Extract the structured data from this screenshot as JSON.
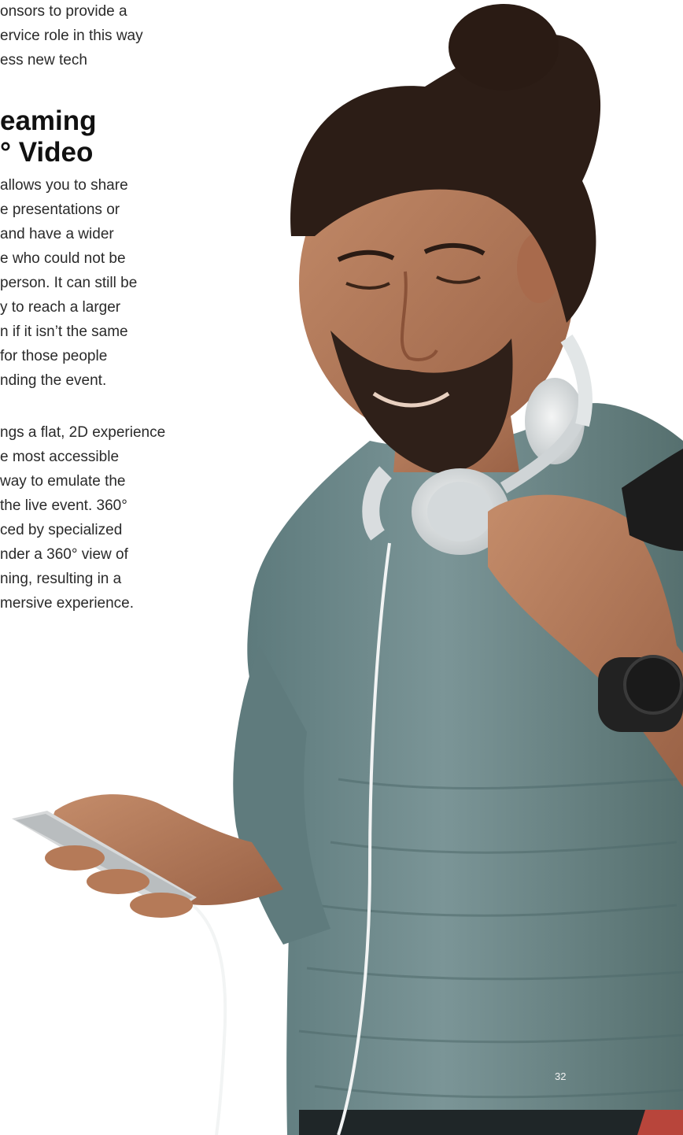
{
  "intro_lines": [
    "onsors to provide a",
    "ervice role in this way",
    "ess new tech"
  ],
  "heading_lines": [
    "eaming",
    "° Video"
  ],
  "paragraph1_lines": [
    "allows you to share",
    "e presentations or",
    "and have a wider",
    "e who could not be",
    "person. It can still be",
    "y to reach a larger",
    "n if it isn’t the same",
    "for those people",
    "nding the event."
  ],
  "paragraph2_lines": [
    "ngs a flat, 2D experience",
    "e most accessible",
    "way to emulate the",
    "the live event. 360°",
    "ced by specialized",
    "nder a 360° view of",
    "ning, resulting in a",
    "mersive experience."
  ],
  "page_number": "32",
  "colors": {
    "shirt": "#6f8a8c",
    "skin": "#b67a5a",
    "hair": "#2c1d16",
    "headphones": "#e4e7e8",
    "background": "#ffffff"
  },
  "image": {
    "subject": "man-with-headphones-looking-at-phone"
  }
}
